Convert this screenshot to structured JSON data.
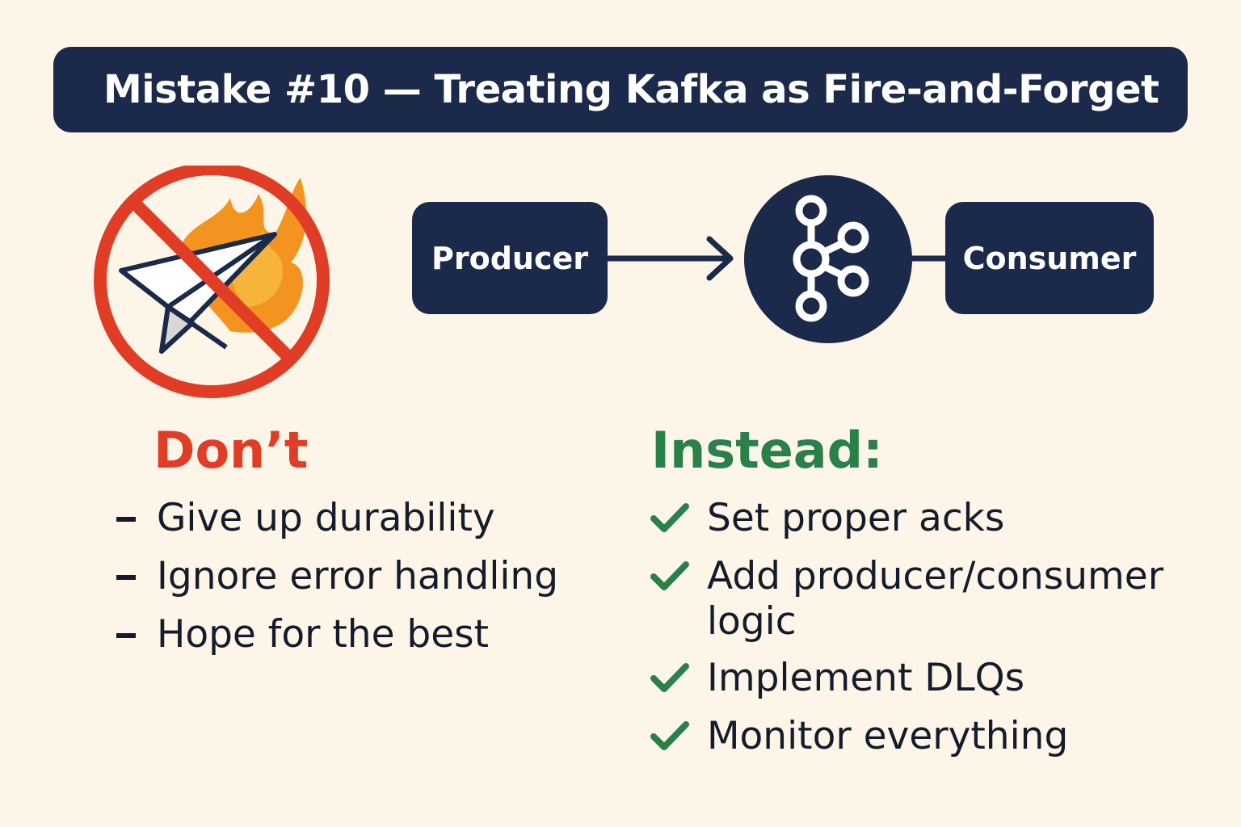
{
  "title": "Mistake #10 — Treating Kafka as Fire-and-Forget",
  "diagram": {
    "producer_label": "Producer",
    "consumer_label": "Consumer",
    "broker_icon": "kafka-logo-icon",
    "prohibited_icon": "no-fire-and-forget-icon"
  },
  "dont": {
    "heading": "Don’t",
    "items": [
      "Give up durability",
      "Ignore error handling",
      "Hope for the best"
    ]
  },
  "instead": {
    "heading": "Instead:",
    "items": [
      "Set proper acks",
      "Add producer/consumer logic",
      "Implement DLQs",
      "Monitor everything"
    ]
  },
  "colors": {
    "navy": "#1b2a4a",
    "background": "#fdf6e8",
    "dont_red": "#e03c26",
    "instead_green": "#2a8049",
    "flame_orange": "#f39421"
  }
}
